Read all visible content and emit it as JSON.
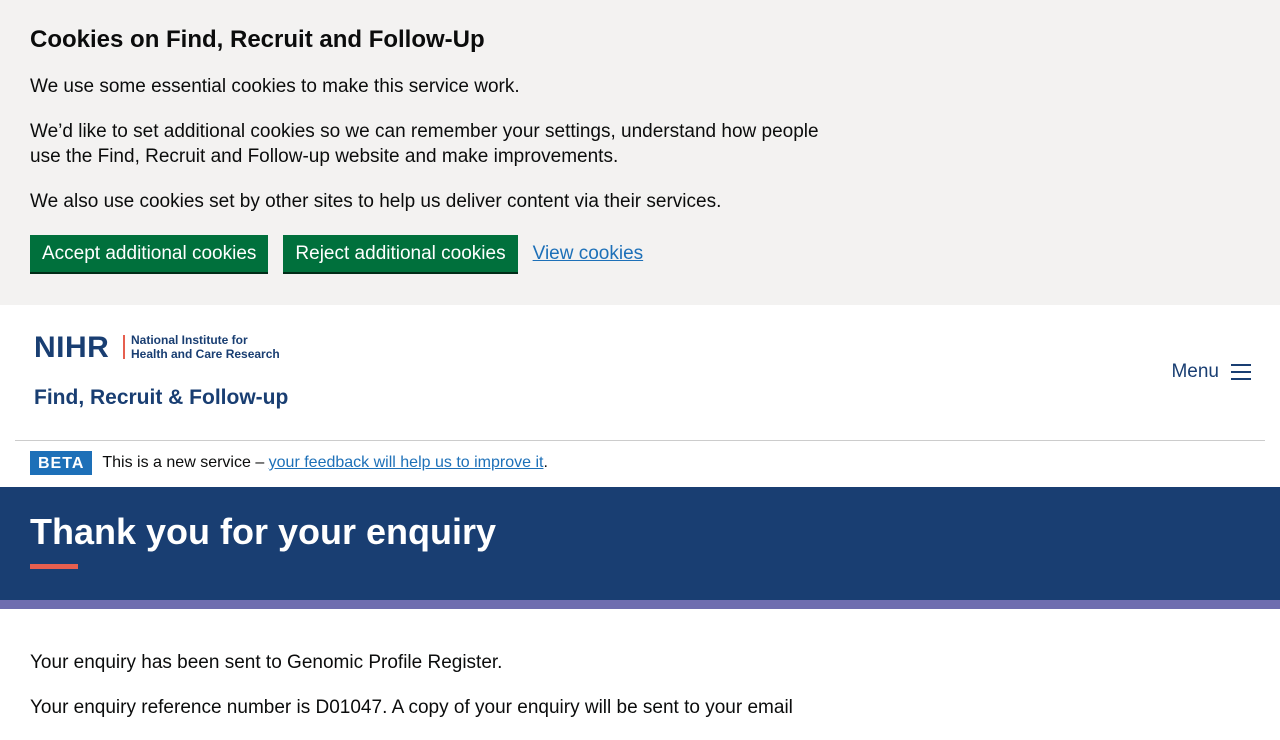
{
  "cookie_banner": {
    "title": "Cookies on Find, Recruit and Follow-Up",
    "paragraphs": [
      "We use some essential cookies to make this service work.",
      "We’d like to set additional cookies so we can remember your settings, understand how people use the Find, Recruit and Follow-up website and make improvements.",
      "We also use cookies set by other sites to help us deliver content via their services."
    ],
    "accept_label": "Accept additional cookies",
    "reject_label": "Reject additional cookies",
    "view_label": "View cookies"
  },
  "header": {
    "logo_abbr": "NIHR",
    "logo_org_line1": "National Institute for",
    "logo_org_line2": "Health and Care Research",
    "service_name": "Find, Recruit & Follow-up",
    "menu_label": "Menu"
  },
  "phase_banner": {
    "tag": "BETA",
    "text_before": "This is a new service – ",
    "link_text": "your feedback will help us to improve it",
    "text_after": "."
  },
  "hero": {
    "title": "Thank you for your enquiry"
  },
  "main": {
    "paragraphs": [
      "Your enquiry has been sent to Genomic Profile Register.",
      "Your enquiry reference number is D01047. A copy of your enquiry will be sent to your email"
    ]
  },
  "colors": {
    "cookie_bg": "#f3f2f1",
    "button_green": "#00703c",
    "link_blue": "#1d70b8",
    "brand_navy": "#193e72",
    "accent_coral": "#e65f4f",
    "stripe_purple": "#6e6daf"
  }
}
